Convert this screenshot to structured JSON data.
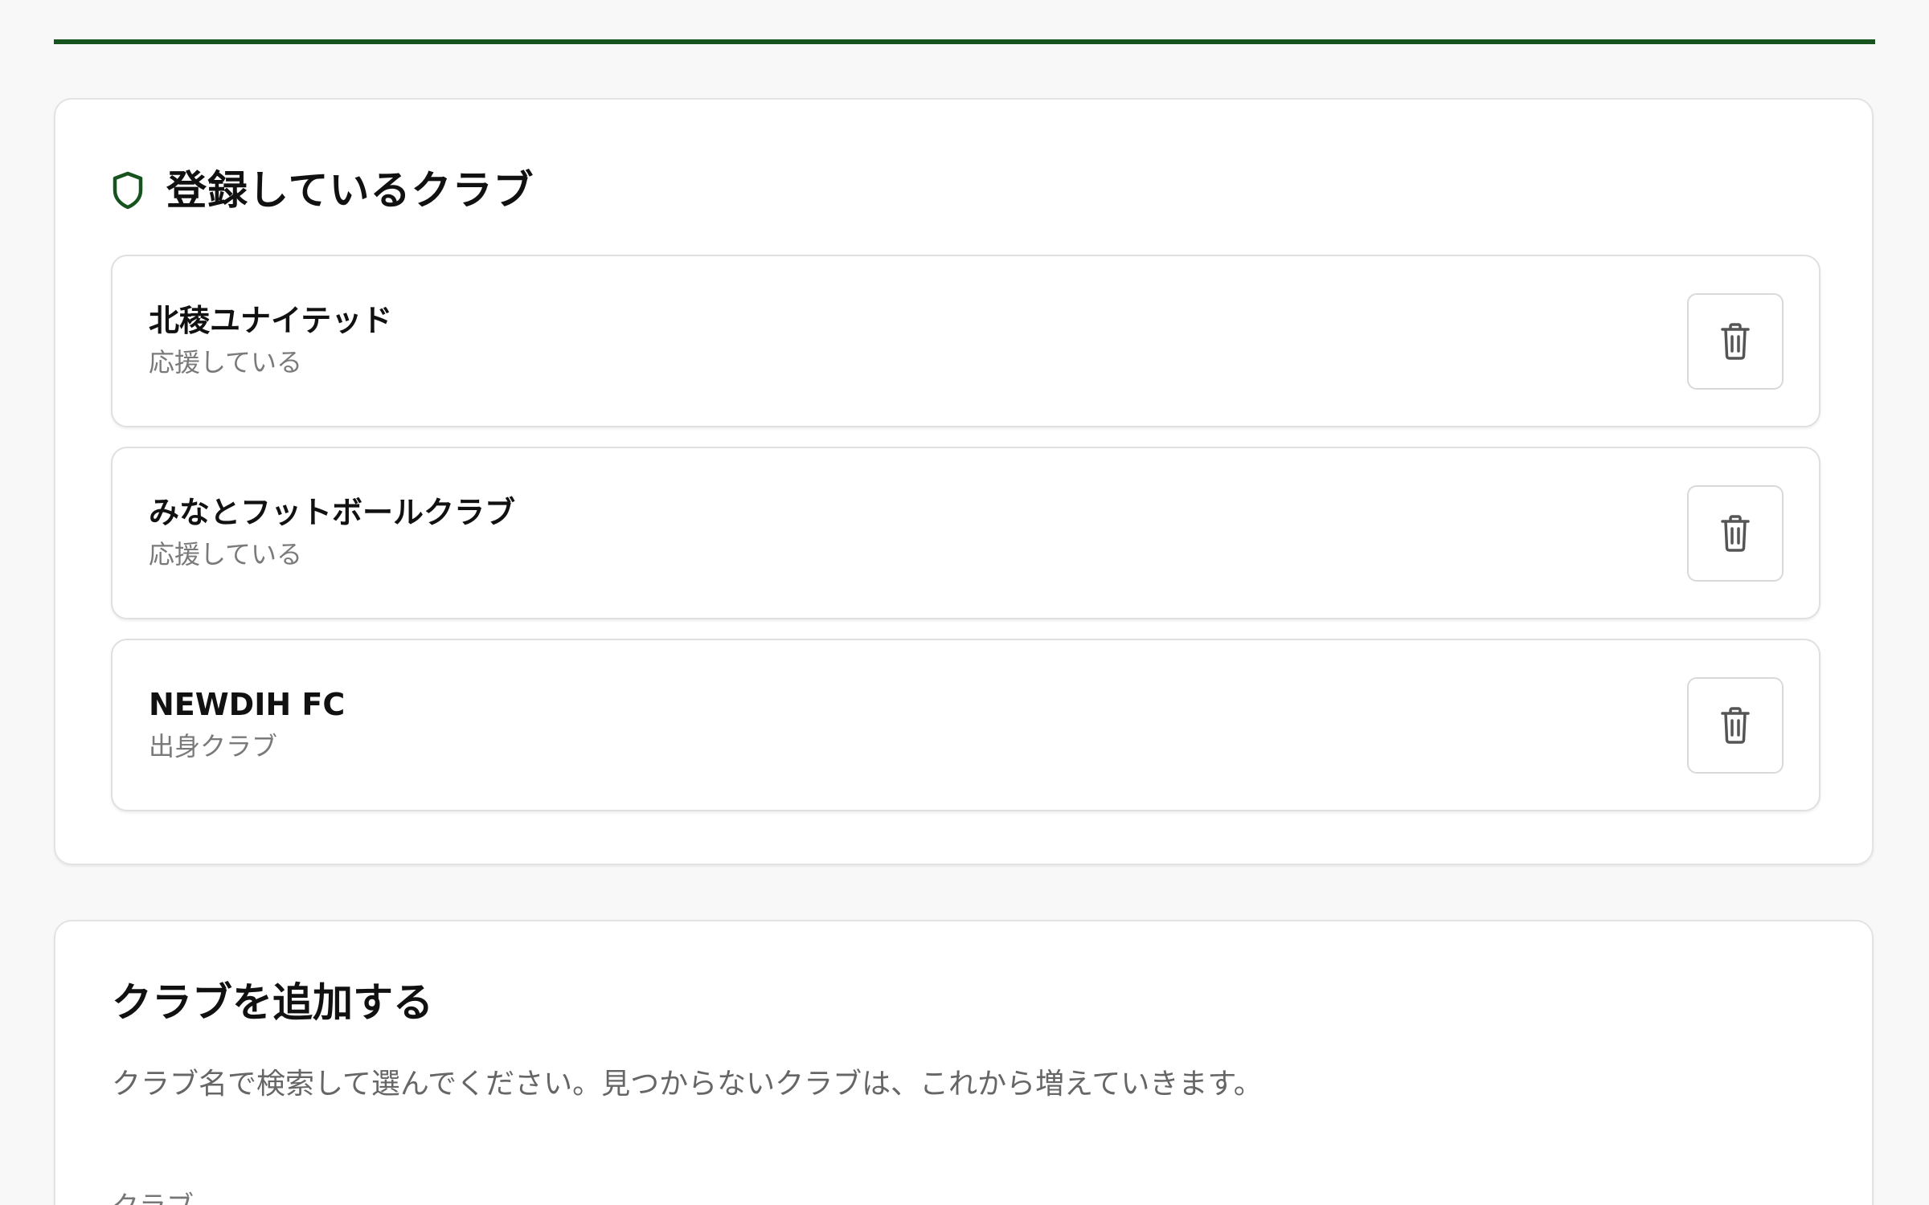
{
  "registered": {
    "title": "登録しているクラブ",
    "title_icon": "shield-icon",
    "clubs": [
      {
        "name": "北稜ユナイテッド",
        "relation": "応援している",
        "action_icon": "trash-icon"
      },
      {
        "name": "みなとフットボールクラブ",
        "relation": "応援している",
        "action_icon": "trash-icon"
      },
      {
        "name": "NEWDIH FC",
        "relation": "出身クラブ",
        "action_icon": "trash-icon"
      }
    ]
  },
  "add_club": {
    "title": "クラブを追加する",
    "description": "クラブ名で検索して選んでください。見つからないクラブは、これから増えていきます。",
    "field_label": "クラブ"
  },
  "colors": {
    "accent": "#17531f",
    "background": "#f8f8f8",
    "card": "#ffffff",
    "muted_text": "#7a7a7a"
  }
}
